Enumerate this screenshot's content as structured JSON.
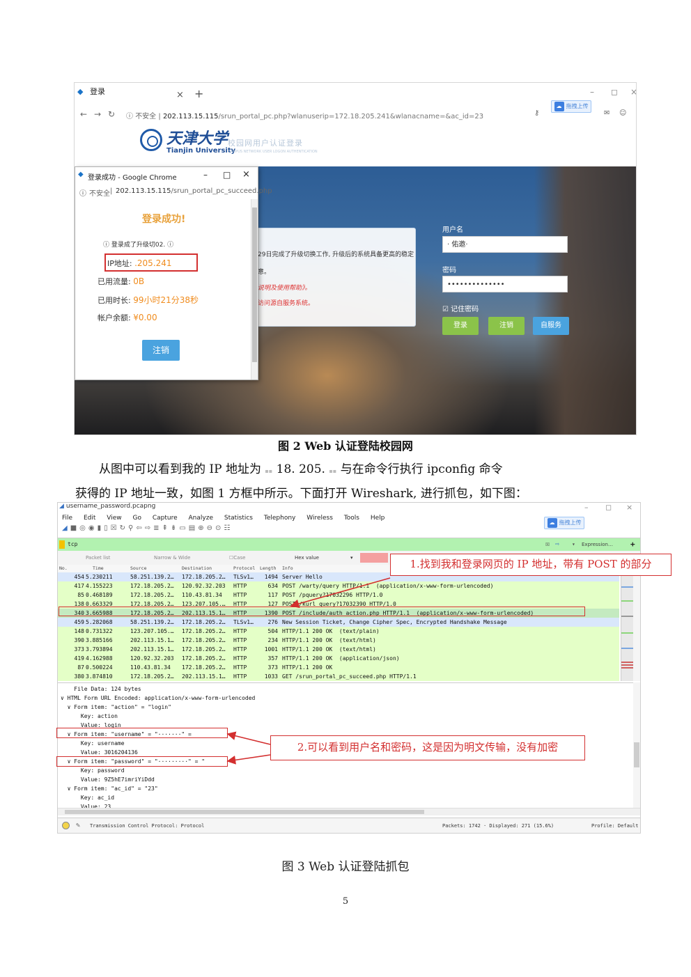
{
  "figure2": {
    "browser": {
      "tab_title": "登录",
      "tab_close": "×",
      "tab_new": "+",
      "min": "–",
      "max": "◻",
      "close": "×",
      "insecure_label": "不安全",
      "url_host": "202.113.15.115",
      "url_rest": "/srun_portal_pc.php?wlanuserip=172.18.205.241&wlanacname=&ac_id=23",
      "upload_badge": "拖拽上传"
    },
    "portal": {
      "logo_cn": "天津大学",
      "logo_en": "Tianjin University",
      "subtitle": "校园网用户认证登录",
      "subtitle_en": "CAMPUS NETWORK USER LOGON AUTHENTICATION",
      "notice_lines": [
        "29日完成了升级切换工作, 升级后的系统具备更高的稳定",
        "意。",
        "说明及使用帮助》。",
        "访问源自服务系统。"
      ],
      "username_label": "用户名",
      "username_value": "· 佑邀·",
      "password_label": "密码",
      "password_value": "••••••••••••••",
      "remember": "记住密码",
      "btn_login": "登录",
      "btn_logout": "注销",
      "btn_self": "自服务"
    },
    "popup": {
      "title": "登录成功 - Google Chrome",
      "min": "–",
      "max": "□",
      "close": "×",
      "insecure_label": "不安全",
      "url_host": "202.113.15.115",
      "url_rest": "/srun_portal_pc_succeed.php",
      "success": "登录成功!",
      "overlay_text": "登录成了升级切02.",
      "ip_label": "IP地址:",
      "ip_value": ".205.241",
      "flow_label": "已用流量:",
      "flow_value": "0B",
      "time_label": "已用时长:",
      "time_value": "99小时21分38秒",
      "balance_label": "帐户余额:",
      "balance_value": "¥0.00",
      "logout": "注销"
    },
    "caption": "图 2 Web 认证登陆校园网"
  },
  "paragraph": {
    "line1_a": "从图中可以看到我的 IP 地址为",
    "line1_b": "18. 205.",
    "line1_c": "与在命令行执行 ipconfig 命令",
    "line2": "获得的 IP 地址一致，如图 1 方框中所示。下面打开 Wireshark, 进行抓包，如下图："
  },
  "figure3": {
    "title": "username_password.pcapng",
    "win_min": "–",
    "win_max": "◻",
    "win_close": "×",
    "upload_badge": "拖拽上传",
    "menu": [
      "File",
      "Edit",
      "View",
      "Go",
      "Capture",
      "Analyze",
      "Statistics",
      "Telephony",
      "Wireless",
      "Tools",
      "Help"
    ],
    "filter": "tcp",
    "expression": "Expression…",
    "plus": "+",
    "search": {
      "scope": "Packet list",
      "width": "Narrow & Wide",
      "case": "Case sensitive",
      "type": "Hex value"
    },
    "columns": [
      "No.",
      "Time",
      "Source",
      "Destination",
      "Protocol",
      "Length",
      "Info"
    ],
    "rows": [
      {
        "no": "454",
        "time": "5.230211",
        "src": "58.251.139.2…",
        "dst": "172.18.205.2…",
        "proto": "TLSv1…",
        "len": "1494",
        "info": "Server Hello",
        "bg": "#d9e7fb"
      },
      {
        "no": "417",
        "time": "4.155223",
        "src": "172.18.205.2…",
        "dst": "120.92.32.203",
        "proto": "HTTP",
        "len": "634",
        "info": "POST /warty/query HTTP/1.1  (application/x-www-form-urlencoded)",
        "bg": "#e4ffc7"
      },
      {
        "no": "85",
        "time": "0.468189",
        "src": "172.18.205.2…",
        "dst": "110.43.81.34",
        "proto": "HTTP",
        "len": "117",
        "info": "POST /pquery?17032296 HTTP/1.0",
        "bg": "#e4ffc7"
      },
      {
        "no": "138",
        "time": "0.663329",
        "src": "172.18.205.2…",
        "dst": "123.207.105.…",
        "proto": "HTTP",
        "len": "127",
        "info": "POST /kurl_query?17032390 HTTP/1.0",
        "bg": "#e4ffc7"
      },
      {
        "no": "340",
        "time": "3.665988",
        "src": "172.18.205.2…",
        "dst": "202.113.15.1…",
        "proto": "HTTP",
        "len": "1390",
        "info": "POST /include/auth_action.php HTTP/1.1  (application/x-www-form-urlencoded)",
        "bg": "#c4eac0"
      },
      {
        "no": "459",
        "time": "5.282068",
        "src": "58.251.139.2…",
        "dst": "172.18.205.2…",
        "proto": "TLSv1…",
        "len": "276",
        "info": "New Session Ticket, Change Cipher Spec, Encrypted Handshake Message",
        "bg": "#d9e7fb"
      },
      {
        "no": "148",
        "time": "0.731322",
        "src": "123.207.105.…",
        "dst": "172.18.205.2…",
        "proto": "HTTP",
        "len": "504",
        "info": "HTTP/1.1 200 OK  (text/plain)",
        "bg": "#e4ffc7"
      },
      {
        "no": "390",
        "time": "3.885166",
        "src": "202.113.15.1…",
        "dst": "172.18.205.2…",
        "proto": "HTTP",
        "len": "234",
        "info": "HTTP/1.1 200 OK  (text/html)",
        "bg": "#e4ffc7"
      },
      {
        "no": "373",
        "time": "3.793894",
        "src": "202.113.15.1…",
        "dst": "172.18.205.2…",
        "proto": "HTTP",
        "len": "1001",
        "info": "HTTP/1.1 200 OK  (text/html)",
        "bg": "#e4ffc7"
      },
      {
        "no": "419",
        "time": "4.162988",
        "src": "120.92.32.203",
        "dst": "172.18.205.2…",
        "proto": "HTTP",
        "len": "357",
        "info": "HTTP/1.1 200 OK  (application/json)",
        "bg": "#e4ffc7"
      },
      {
        "no": "87",
        "time": "0.500224",
        "src": "110.43.81.34",
        "dst": "172.18.205.2…",
        "proto": "HTTP",
        "len": "373",
        "info": "HTTP/1.1 200 OK",
        "bg": "#e4ffc7"
      },
      {
        "no": "380",
        "time": "3.874810",
        "src": "172.18.205.2…",
        "dst": "202.113.15.1…",
        "proto": "HTTP",
        "len": "1033",
        "info": "GET /srun_portal_pc_succeed.php HTTP/1.1",
        "bg": "#e4ffc7"
      }
    ],
    "details": [
      "    File Data: 124 bytes",
      "∨ HTML Form URL Encoded: application/x-www-form-urlencoded",
      "  ∨ Form item: \"action\" = \"login\"",
      "      Key: action",
      "      Value: login",
      "  ∨ Form item: \"username\" = \"·······\" =",
      "      Key: username",
      "      Value: 3016204136",
      "  ∨ Form item: \"password\" = \"·········\" = \"",
      "      Key: password",
      "      Value: 9Z5hE7imriYiDdd",
      "  ∨ Form item: \"ac_id\" = \"23\"",
      "      Key: ac_id",
      "      Value: 23"
    ],
    "status_left": "Transmission Control Protocol: Protocol",
    "status_packets": "Packets: 1742 · Displayed: 271 (15.6%)",
    "status_profile": "Profile: Default",
    "annotation1": "1.找到我和登录网页的 IP 地址，带有 POST 的部分",
    "annotation2": "2.可以看到用户名和密码，这是因为明文传输，没有加密",
    "caption": "图 3 Web 认证登陆抓包"
  },
  "page_number": "5",
  "colors": {
    "annotation_red": "#d32f2f",
    "http_row": "#e4ffc7",
    "tls_row": "#d9e7fb",
    "filter_bg": "#b2f2b0"
  }
}
